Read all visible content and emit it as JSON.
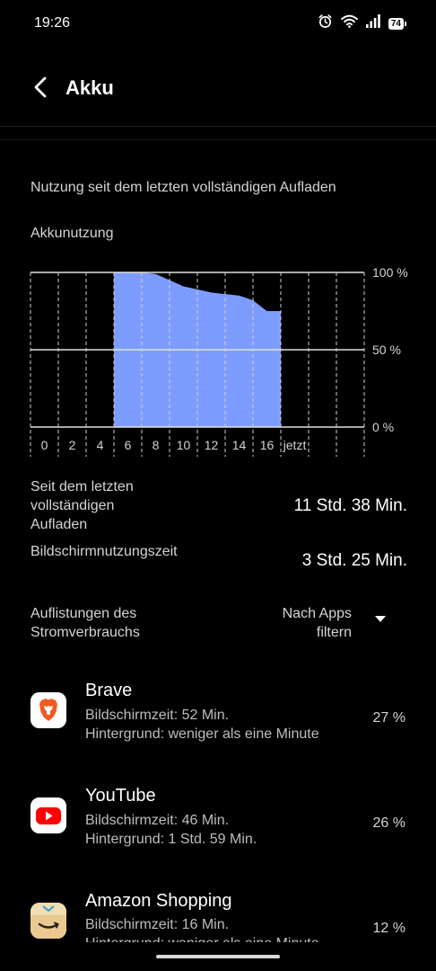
{
  "status_bar": {
    "time": "19:26",
    "battery": "74",
    "icons": [
      "alarm-icon",
      "wifi-icon",
      "signal-icon",
      "battery-icon"
    ]
  },
  "header": {
    "title": "Akku",
    "back_icon": "back-arrow-icon"
  },
  "usage_section": {
    "since_label": "Nutzung seit dem letzten vollständigen Aufladen",
    "chart_title": "Akkunutzung"
  },
  "chart_data": {
    "type": "area",
    "title": "Akkunutzung",
    "x_labels": [
      "0",
      "2",
      "4",
      "6",
      "8",
      "10",
      "12",
      "14",
      "16",
      "jetzt"
    ],
    "y_labels": [
      "100 %",
      "50 %",
      "0 %"
    ],
    "ylim": [
      0,
      100
    ],
    "xlim": [
      0,
      24
    ],
    "x": [
      6,
      8,
      9,
      10,
      11,
      12,
      13,
      14,
      15,
      16,
      17,
      18
    ],
    "y": [
      100,
      100,
      99,
      95,
      91,
      89,
      87,
      86,
      85,
      82,
      75,
      75
    ],
    "fill_color": "#7d9cff",
    "grid": true
  },
  "stats": {
    "since_full_label": "Seit dem letzten vollständigen Aufladen",
    "since_full_value": "11 Std. 38 Min.",
    "screen_time_label": "Bildschirmnutzungszeit",
    "screen_time_value": "3 Std. 25 Min."
  },
  "listing": {
    "label": "Auflistungen des Stromverbrauchs",
    "filter_label": "Nach Apps filtern"
  },
  "apps": [
    {
      "name": "Brave",
      "screen": "Bildschirmzeit: 52 Min.",
      "background": "Hintergrund: weniger als eine Minute",
      "percent": "27 %",
      "icon": "brave-icon"
    },
    {
      "name": "YouTube",
      "screen": "Bildschirmzeit: 46 Min.",
      "background": "Hintergrund: 1 Std. 59 Min.",
      "percent": "26 %",
      "icon": "youtube-icon"
    },
    {
      "name": "Amazon Shopping",
      "screen": "Bildschirmzeit: 16 Min.",
      "background": "Hintergrund: weniger als eine Minute",
      "percent": "12 %",
      "icon": "amazon-icon"
    }
  ]
}
